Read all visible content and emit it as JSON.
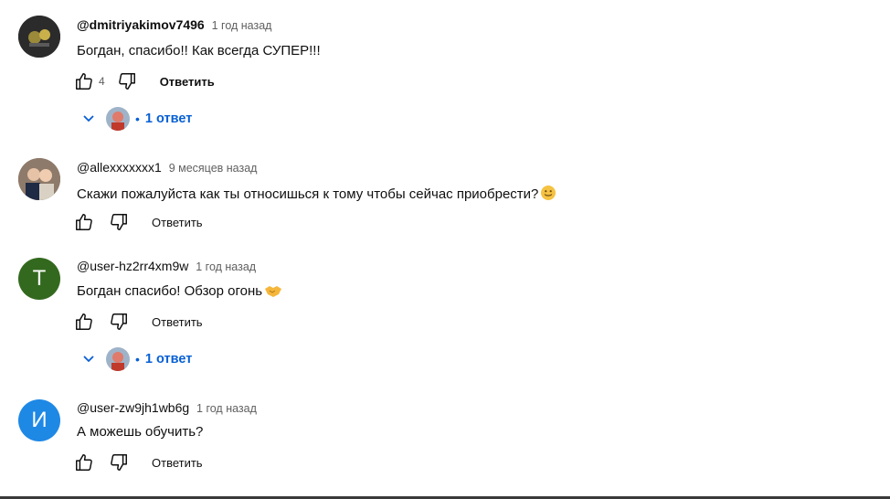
{
  "comments": [
    {
      "author": "@dmitriyakimov7496",
      "time": "1 год назад",
      "text": "Богдан, спасибо!! Как всегда СУПЕР!!!",
      "likes": "4",
      "reply_label": "Ответить",
      "replies_label": "1 ответ",
      "avatar_color": "#2b2b2b"
    },
    {
      "author": "@allexxxxxxx1",
      "time": "9 месяцев назад",
      "text": "Скажи пожалуйста как ты относишься к тому чтобы сейчас приобрести?",
      "reply_label": "Ответить",
      "avatar_color": "#7a5a48"
    },
    {
      "author": "@user-hz2rr4xm9w",
      "time": "1 год назад",
      "text": "Богдан спасибо! Обзор огонь",
      "reply_label": "Ответить",
      "replies_label": "1 ответ",
      "avatar_letter": "Т",
      "avatar_color": "#33691e"
    },
    {
      "author": "@user-zw9jh1wb6g",
      "time": "1 год назад",
      "text": "А можешь обучить?",
      "reply_label": "Ответить",
      "avatar_letter": "И",
      "avatar_color": "#1e88e5"
    }
  ],
  "colors": {
    "link_blue": "#065fd4",
    "meta_gray": "#606060"
  },
  "icons": [
    "thumb-up-icon",
    "thumb-down-icon",
    "chevron-down-icon",
    "smile-emoji-icon",
    "handshake-emoji-icon"
  ]
}
